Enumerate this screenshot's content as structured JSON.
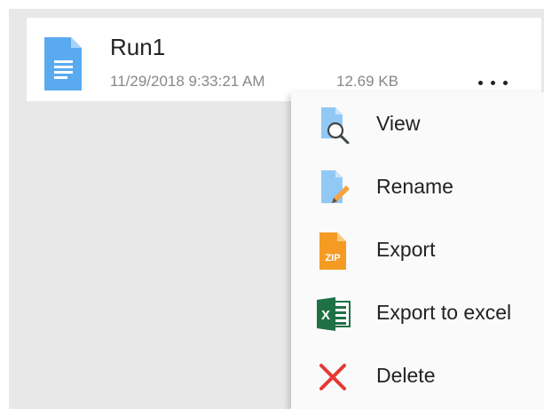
{
  "file": {
    "name": "Run1",
    "date": "11/29/2018 9:33:21 AM",
    "size": "12.69 KB",
    "icon": "document-icon"
  },
  "more_button": {
    "icon": "more-horizontal-icon"
  },
  "menu": {
    "items": [
      {
        "label": "View",
        "icon": "view-search-icon"
      },
      {
        "label": "Rename",
        "icon": "rename-pencil-icon"
      },
      {
        "label": "Export",
        "icon": "zip-file-icon",
        "icon_text": "ZIP"
      },
      {
        "label": "Export to excel",
        "icon": "excel-icon",
        "icon_text": "X"
      },
      {
        "label": "Delete",
        "icon": "delete-x-icon"
      }
    ]
  },
  "colors": {
    "doc_blue": "#5aaaf0",
    "zip_orange": "#f59b23",
    "excel_green": "#1e7145",
    "delete_red": "#e53935"
  }
}
